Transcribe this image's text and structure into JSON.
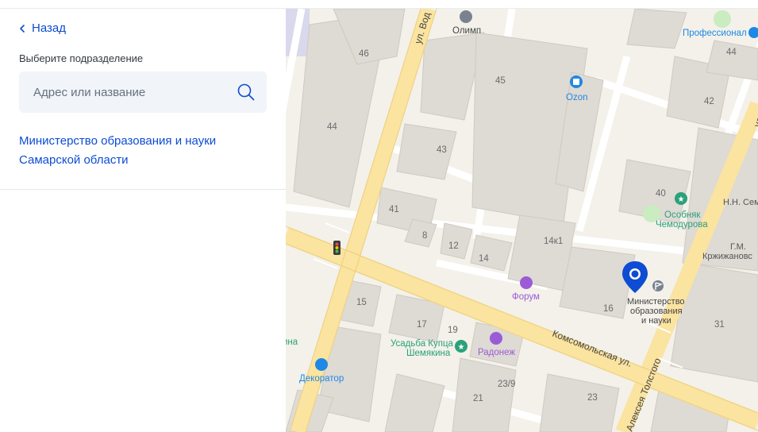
{
  "sidebar": {
    "back_label": "Назад",
    "section_label": "Выберите подразделение",
    "search": {
      "placeholder": "Адрес или название",
      "value": ""
    },
    "results": [
      {
        "label": "Министерство образования и науки Самарской области"
      }
    ]
  },
  "map": {
    "streets": {
      "vod": "ул. Вод",
      "komsomolskaya": "Комсомольская ул.",
      "tolstogo": "Алексея Толстого",
      "right_edge": "ул"
    },
    "house_numbers": [
      "46",
      "44",
      "45",
      "43",
      "41",
      "8",
      "12",
      "14",
      "14к1",
      "15",
      "17",
      "19",
      "16",
      "40",
      "42",
      "44",
      "31",
      "21",
      "23/9",
      "23"
    ],
    "pois": {
      "olimp": "Олимп",
      "ozon": "Ozon",
      "professional": "Профессионал",
      "osobnyak_line1": "Особняк",
      "osobnyak_line2": "Чемодурова",
      "nn_sem": "Н.Н. Сем",
      "gm_line1": "Г.М.",
      "gm_line2": "Кржижановс",
      "forum": "Форум",
      "usadba_line1": "Усадьба Купца",
      "usadba_line2": "Шемякина",
      "radonezh": "Радонеж",
      "dekorator": "Декоратор",
      "left_edge": "ина"
    },
    "marker": {
      "line1": "Министерство",
      "line2": "образования",
      "line3": "и науки"
    },
    "colors": {
      "marker": "#0d4cd3",
      "road_major": "#fbe3a0",
      "building": "#dedad4",
      "green_poi": "#2aa17a",
      "blue_poi": "#1e88e5",
      "violet_poi": "#9c5bd6"
    }
  }
}
